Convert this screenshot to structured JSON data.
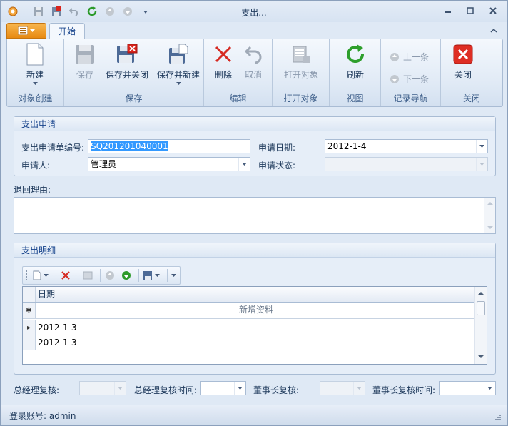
{
  "window": {
    "title": "支出..."
  },
  "ribbon": {
    "app_button": "",
    "tab_home": "开始",
    "groups": {
      "create": "对象创建",
      "save": "保存",
      "edit": "编辑",
      "open": "打开对象",
      "view": "视图",
      "nav": "记录导航",
      "close": "关闭"
    },
    "buttons": {
      "new": "新建",
      "save": "保存",
      "save_close": "保存并关闭",
      "save_new": "保存并新建",
      "delete": "删除",
      "cancel": "取消",
      "open_object": "打开对象",
      "refresh": "刷新",
      "prev": "上一条",
      "next": "下一条",
      "close": "关闭"
    }
  },
  "form": {
    "section_title": "支出申请",
    "number_label": "支出申请单编号:",
    "number_value": "SQ201201040001",
    "date_label": "申请日期:",
    "date_value": "2012-1-4",
    "applicant_label": "申请人:",
    "applicant_value": "管理员",
    "status_label": "申请状态:",
    "status_value": "",
    "reject_label": "退回理由:",
    "reject_value": ""
  },
  "detail": {
    "section_title": "支出明细",
    "column_date": "日期",
    "new_row_text": "新增资料",
    "rows": [
      "2012-1-3",
      "2012-1-3"
    ]
  },
  "review": {
    "gm_review_label": "总经理复核:",
    "gm_time_label": "总经理复核时间:",
    "chair_review_label": "董事长复核:",
    "chair_time_label": "董事长复核时间:"
  },
  "status": {
    "login": "登录账号: admin"
  }
}
